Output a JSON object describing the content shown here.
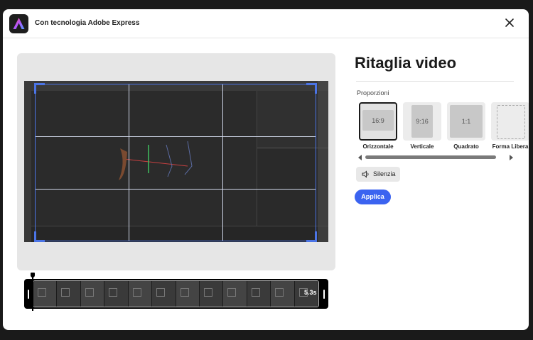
{
  "header": {
    "title": "Con tecnologia Adobe Express",
    "close_icon": "close-icon",
    "logo_icon": "adobe-express-logo-icon"
  },
  "panel": {
    "title": "Ritaglia video",
    "proportions_label": "Proporzioni",
    "ratios": [
      {
        "ratio": "16:9",
        "name": "Orizzontale",
        "selected": true
      },
      {
        "ratio": "9:16",
        "name": "Verticale",
        "selected": false
      },
      {
        "ratio": "1:1",
        "name": "Quadrato",
        "selected": false
      },
      {
        "ratio": "",
        "name": "Forma Libera",
        "selected": false
      }
    ],
    "mute_label": "Silenzia",
    "mute_icon": "speaker-icon",
    "apply_label": "Applica"
  },
  "timeline": {
    "duration": "5.3s"
  },
  "colors": {
    "accent": "#3b63f0",
    "crop_border": "#4b74e6",
    "dialog_bg": "#ffffff",
    "backdrop": "#1a1a1a"
  }
}
